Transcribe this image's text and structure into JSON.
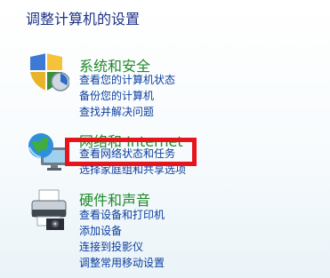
{
  "page": {
    "title": "调整计算机的设置"
  },
  "categories": [
    {
      "icon": "shield-icon",
      "heading": "系统和安全",
      "links": [
        "查看您的计算机状态",
        "备份您的计算机",
        "查找并解决问题"
      ]
    },
    {
      "icon": "network-globe-icon",
      "heading": "网络和 Internet",
      "links": [
        "查看网络状态和任务",
        "选择家庭组和共享选项"
      ]
    },
    {
      "icon": "printer-icon",
      "heading": "硬件和声音",
      "links": [
        "查看设备和打印机",
        "添加设备",
        "连接到投影仪",
        "调整常用移动设置"
      ]
    }
  ],
  "highlight": {
    "color": "#e8141c",
    "target": "查看网络状态和任务"
  }
}
